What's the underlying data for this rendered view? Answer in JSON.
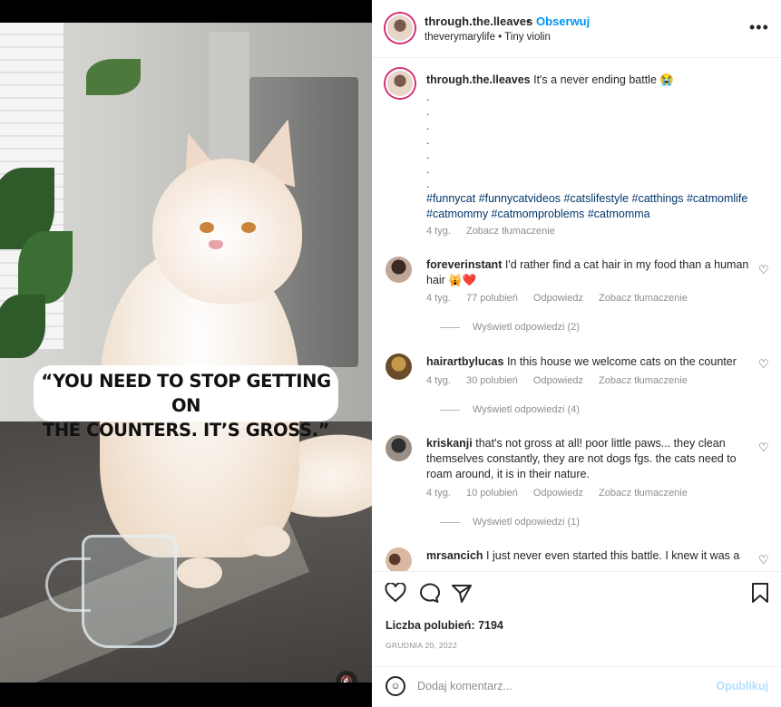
{
  "media": {
    "caption_line1": "“YOU NEED TO STOP GETTING ON",
    "caption_line2": "THE COUNTERS. IT’S GROSS.”",
    "mute_icon": "speaker-muted-icon"
  },
  "header": {
    "username": "through.the.lleaves",
    "separator": "•",
    "follow_label": "Obserwuj",
    "subtitle": "theverymarylife • Tiny violin",
    "more_icon": "more-horizontal-icon"
  },
  "caption": {
    "username": "through.the.lleaves",
    "text": "It's a never ending battle 😭",
    "dots": [
      ".",
      ".",
      ".",
      ".",
      ".",
      ".",
      "."
    ],
    "hashtags_line1": "#funnycat #funnycatvideos #catslifestyle #catthings #catmomlife",
    "hashtags_line2": "#catmommy #catmomproblems #catmomma",
    "time": "4 tyg.",
    "translate": "Zobacz tłumaczenie"
  },
  "comments": [
    {
      "username": "foreverinstant",
      "text": "I'd rather find a cat hair in my food than a human hair 🙀❤️",
      "time": "4 tyg.",
      "likes": "77 polubień",
      "reply": "Odpowiedz",
      "translate": "Zobacz tłumaczenie",
      "view_replies": "Wyświetl odpowiedzi (2)"
    },
    {
      "username": "hairartbylucas",
      "text": "In this house we welcome cats on the counter",
      "time": "4 tyg.",
      "likes": "30 polubień",
      "reply": "Odpowiedz",
      "translate": "Zobacz tłumaczenie",
      "view_replies": "Wyświetl odpowiedzi (4)"
    },
    {
      "username": "kriskanji",
      "text": "that's not gross at all! poor little paws... they clean themselves constantly, they are not dogs fgs. the cats need to roam around, it is in their nature.",
      "time": "4 tyg.",
      "likes": "10 polubień",
      "reply": "Odpowiedz",
      "translate": "Zobacz tłumaczenie",
      "view_replies": "Wyświetl odpowiedzi (1)"
    },
    {
      "username": "mrsancich",
      "text": "I just never even started this battle. I knew it was a"
    }
  ],
  "actions": {
    "like_icon": "heart-outline-icon",
    "comment_icon": "comment-bubble-icon",
    "share_icon": "paper-plane-icon",
    "save_icon": "bookmark-icon",
    "likes_text": "Liczba polubień: 7194",
    "date": "GRUDNIA 20, 2022"
  },
  "compose": {
    "emoji_icon": "smiley-icon",
    "placeholder": "Dodaj komentarz...",
    "post_label": "Opublikuj"
  },
  "colors": {
    "link": "#0095f6",
    "hashtag": "#00376b",
    "muted": "#8e8e8e",
    "text": "#262626"
  }
}
